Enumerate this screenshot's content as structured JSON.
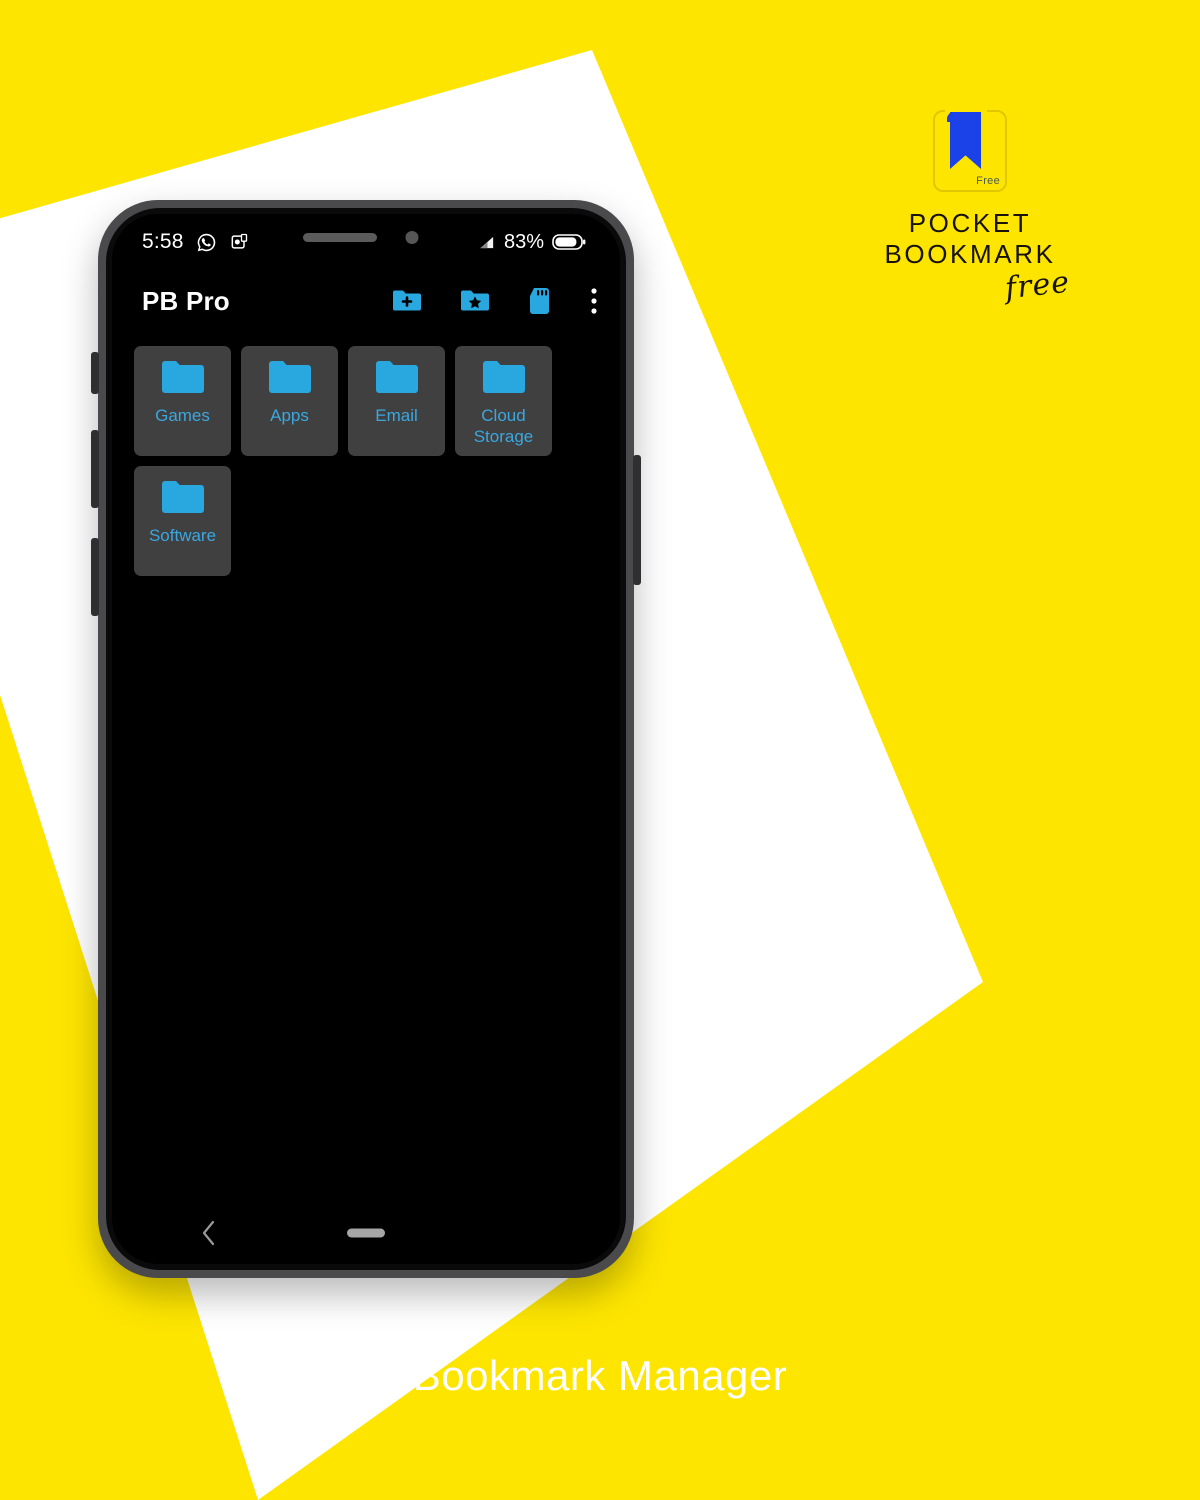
{
  "colors": {
    "background_yellow": "#FDE500",
    "shape_white": "#FFFFFF",
    "accent_blue": "#29A8E0",
    "folder_label_blue": "#3BA7E0",
    "tile_gray": "#404040",
    "brand_blue": "#1B42E8",
    "screen_black": "#000000",
    "frame_gray": "#4A4A4C"
  },
  "brand": {
    "mark_icon": "bookmark-icon",
    "badge_label": "Free",
    "title_line1": "POCKET",
    "title_line2": "BOOKMARK",
    "script_word": "free"
  },
  "phone": {
    "status_bar": {
      "clock": "5:58",
      "notification_icons": [
        "whatsapp-icon",
        "app-notification-icon"
      ],
      "signal_icon": "signal-bars-icon",
      "battery_percent": "83%",
      "battery_icon": "battery-icon"
    },
    "app_bar": {
      "title": "PB Pro",
      "actions": [
        {
          "name": "add-folder-icon",
          "label": "Add folder"
        },
        {
          "name": "favorite-folder-icon",
          "label": "Favorites"
        },
        {
          "name": "sd-card-icon",
          "label": "SD card"
        },
        {
          "name": "overflow-menu-icon",
          "label": "More options"
        }
      ]
    },
    "folders": [
      {
        "label": "Games",
        "icon": "folder-icon"
      },
      {
        "label": "Apps",
        "icon": "folder-icon"
      },
      {
        "label": "Email",
        "icon": "folder-icon"
      },
      {
        "label": "Cloud Storage",
        "icon": "folder-icon"
      },
      {
        "label": "Software",
        "icon": "folder-icon"
      }
    ],
    "nav_bar": {
      "back_icon": "chevron-left-icon",
      "home_indicator": "home-pill-indicator"
    }
  },
  "caption": "Bookmark Manager"
}
